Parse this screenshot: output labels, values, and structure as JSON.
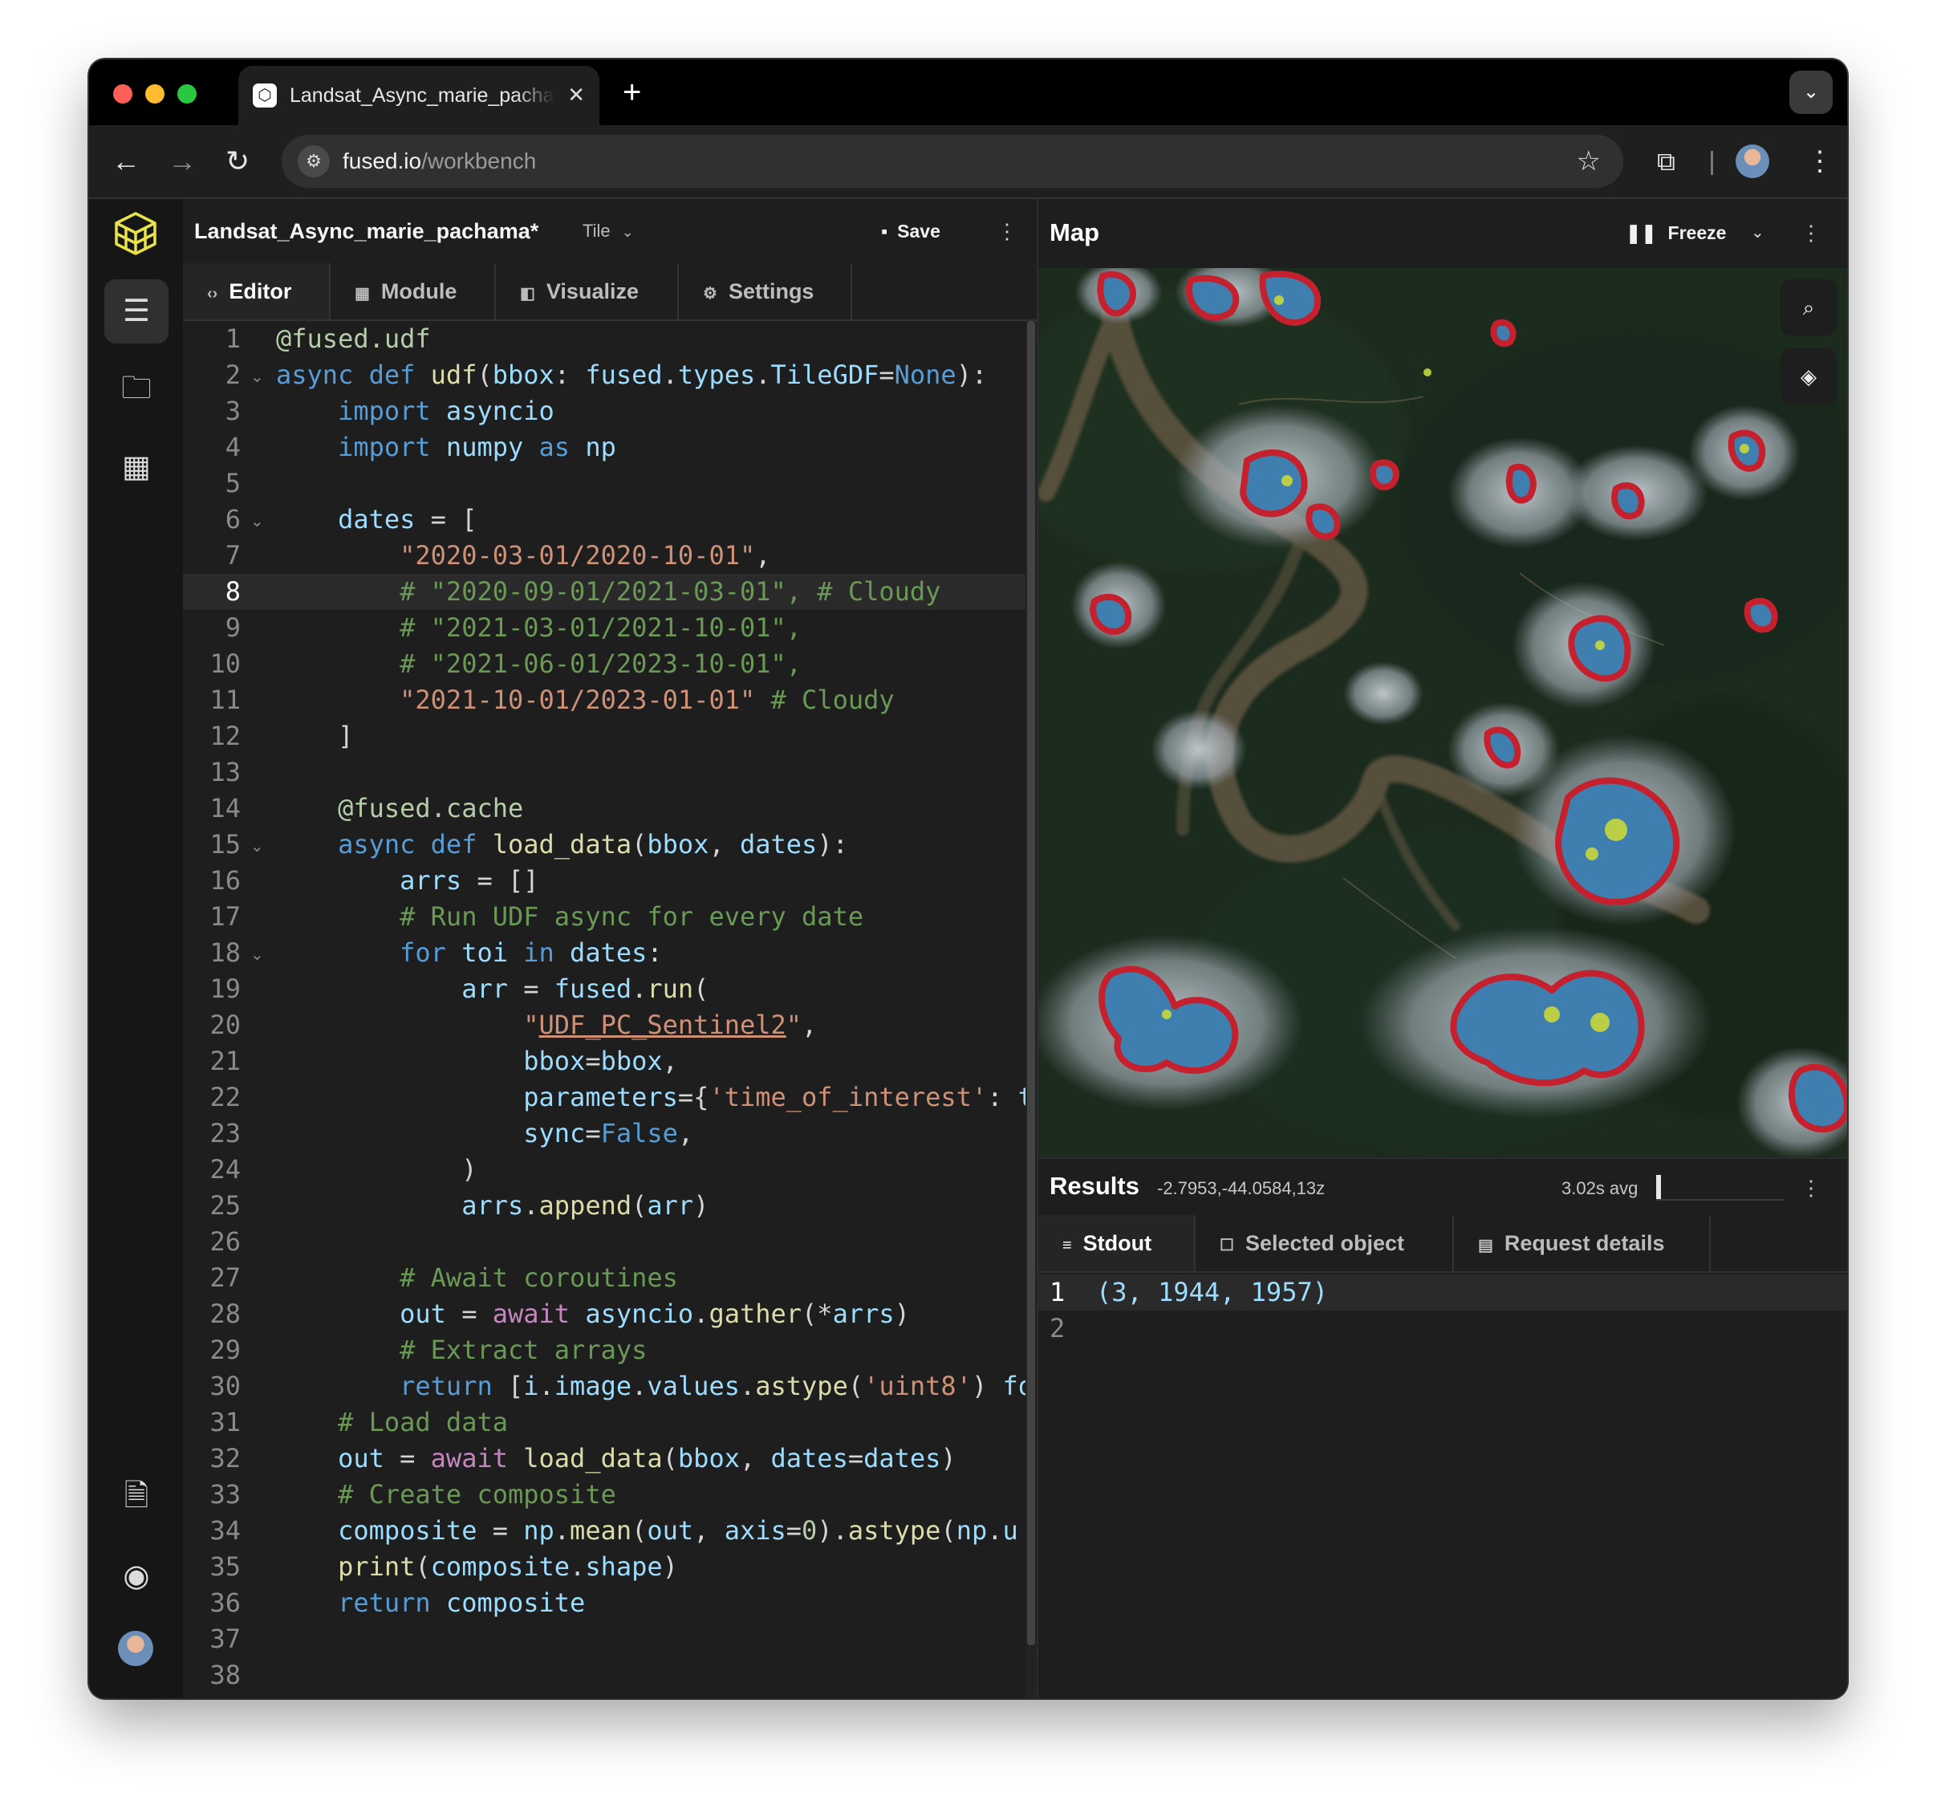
{
  "browser": {
    "tab_title": "Landsat_Async_marie_pachama",
    "tab_close": "✕",
    "new_tab": "+",
    "url_host": "fused.io",
    "url_path": "/workbench"
  },
  "editor": {
    "file_title": "Landsat_Async_marie_pachama*",
    "mode_label": "Tile",
    "save_label": "Save",
    "tabs": [
      {
        "label": "Editor",
        "icon": "code-icon",
        "active": true
      },
      {
        "label": "Module",
        "icon": "grid-icon",
        "active": false
      },
      {
        "label": "Visualize",
        "icon": "visualize-icon",
        "active": false
      },
      {
        "label": "Settings",
        "icon": "gear-icon",
        "active": false
      }
    ],
    "current_line": 8,
    "code_lines": [
      "@fused.udf",
      "async def udf(bbox: fused.types.TileGDF=None):",
      "    import asyncio",
      "    import numpy as np",
      "",
      "    dates = [",
      "        \"2020-03-01/2020-10-01\",",
      "        # \"2020-09-01/2021-03-01\", # Cloudy",
      "        # \"2021-03-01/2021-10-01\",",
      "        # \"2021-06-01/2023-10-01\",",
      "        \"2021-10-01/2023-01-01\" # Cloudy",
      "    ]",
      "",
      "    @fused.cache",
      "    async def load_data(bbox, dates):",
      "        arrs = []",
      "        # Run UDF async for every date",
      "        for toi in dates:",
      "            arr = fused.run(",
      "                \"UDF_PC_Sentinel2\",",
      "                bbox=bbox,",
      "                parameters={'time_of_interest': t",
      "                sync=False,",
      "            )",
      "            arrs.append(arr)",
      "",
      "        # Await coroutines",
      "        out = await asyncio.gather(*arrs)",
      "        # Extract arrays",
      "        return [i.image.values.astype('uint8') fo",
      "    # Load data",
      "    out = await load_data(bbox, dates=dates)",
      "    # Create composite",
      "    composite = np.mean(out, axis=0).astype(np.u",
      "    print(composite.shape)",
      "    return composite",
      "",
      ""
    ]
  },
  "map": {
    "title": "Map",
    "freeze_label": "Freeze"
  },
  "results": {
    "title": "Results",
    "coords": "-2.7953,-44.0584,13z",
    "avg_label": "3.02s avg",
    "avg_fraction": 0.04,
    "tabs": [
      {
        "label": "Stdout",
        "active": true
      },
      {
        "label": "Selected object",
        "active": false
      },
      {
        "label": "Request details",
        "active": false
      }
    ],
    "output_lines": [
      "(3, 1944, 1957)",
      ""
    ]
  },
  "colors": {
    "accent_logo": "#e9e34a",
    "cloud_red": "#c4202e",
    "cloud_blue": "#3f7fb0",
    "cloud_yellow": "#c8d83a"
  }
}
